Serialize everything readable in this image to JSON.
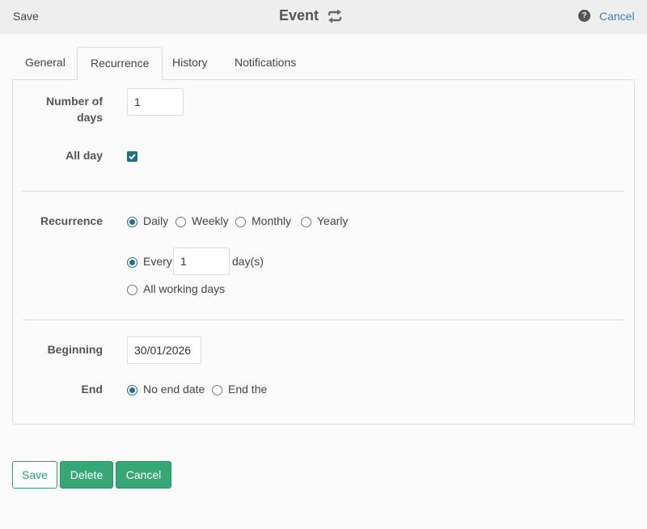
{
  "header": {
    "save_label": "Save",
    "title": "Event",
    "help_icon": "question-circle-icon",
    "cancel_label": "Cancel"
  },
  "tabs": [
    {
      "label": "General",
      "active": false
    },
    {
      "label": "Recurrence",
      "active": true
    },
    {
      "label": "History",
      "active": false
    },
    {
      "label": "Notifications",
      "active": false
    }
  ],
  "form": {
    "number_of_days": {
      "label_line1": "Number of",
      "label_line2": "days",
      "value": "1"
    },
    "all_day": {
      "label": "All day",
      "checked": true
    },
    "recurrence": {
      "label": "Recurrence",
      "options": [
        "Daily",
        "Weekly",
        "Monthly",
        "Yearly"
      ],
      "selected": "Daily",
      "every_label": "Every",
      "every_value": "1",
      "every_unit": "day(s)",
      "all_working_days_label": "All working days"
    },
    "beginning": {
      "label": "Beginning",
      "value": "30/01/2026"
    },
    "end": {
      "label": "End",
      "no_end_label": "No end date",
      "end_the_label": "End the",
      "selected": "No end date"
    }
  },
  "footer": {
    "save_label": "Save",
    "delete_label": "Delete",
    "cancel_label": "Cancel"
  },
  "colors": {
    "accent": "#1f6f8b",
    "button_green": "#35a876",
    "link": "#3b7fbf"
  }
}
